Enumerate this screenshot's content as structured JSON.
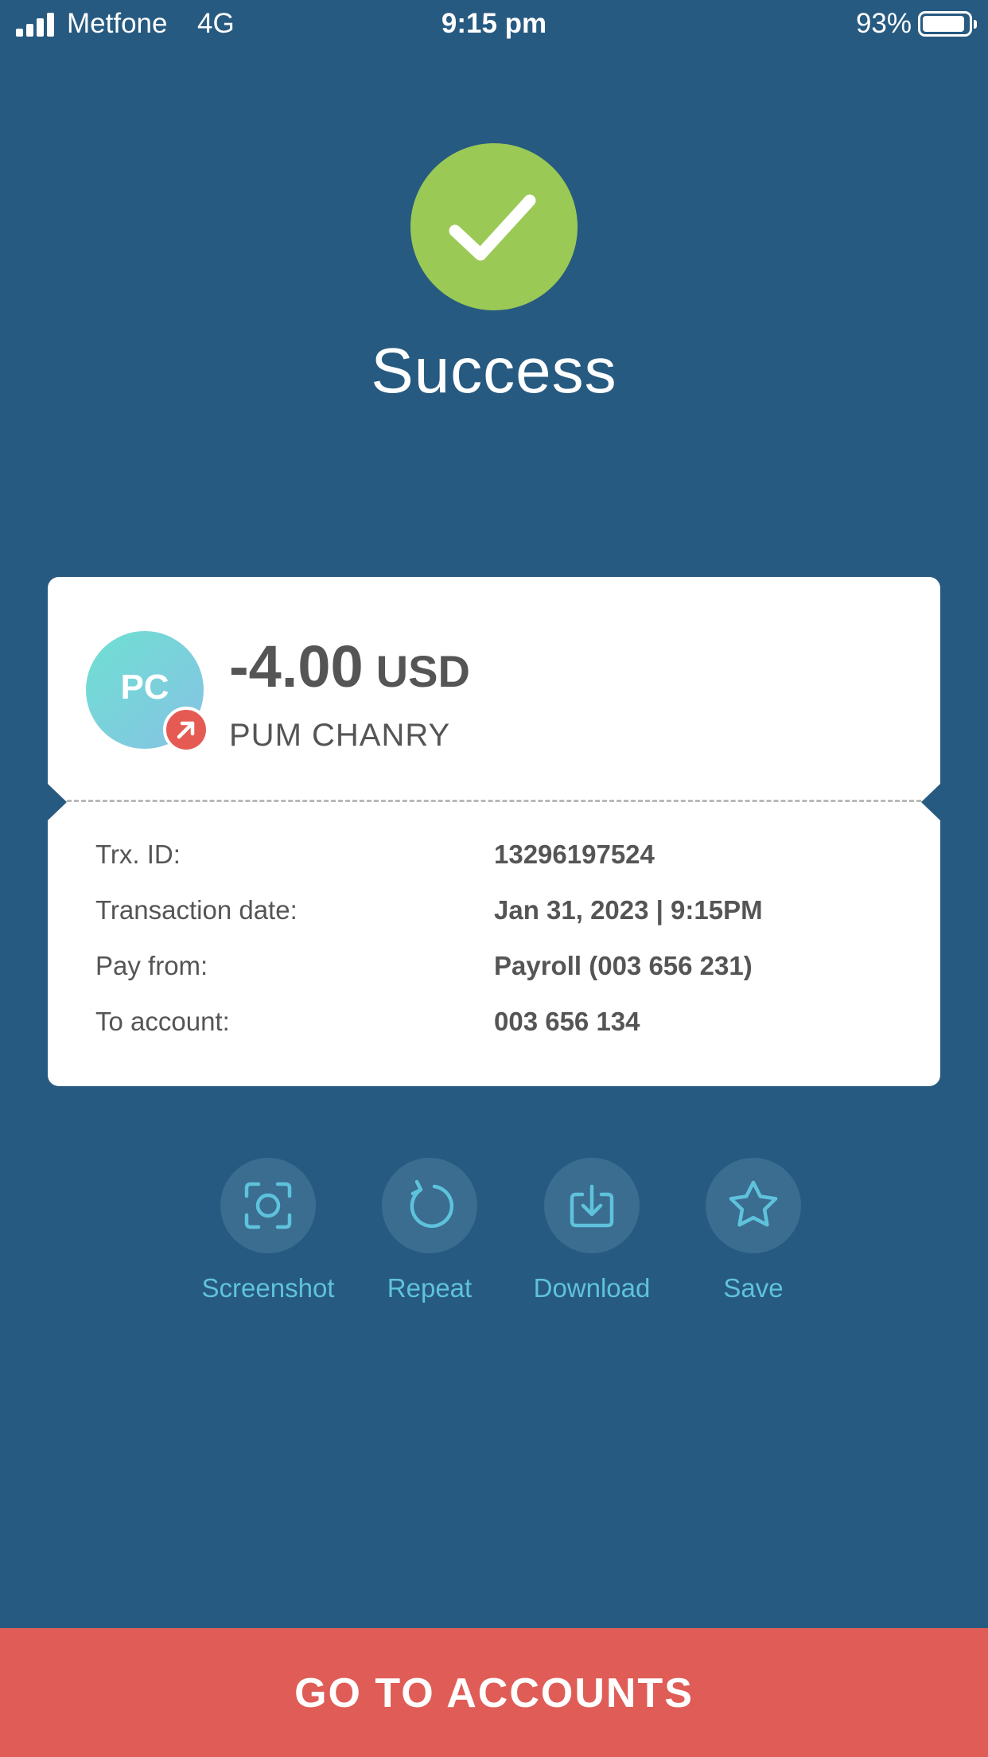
{
  "status_bar": {
    "carrier": "Metfone",
    "network": "4G",
    "time": "9:15 pm",
    "battery": "93%",
    "battery_level": 0.93
  },
  "result": {
    "title": "Success",
    "icon": "checkmark-icon"
  },
  "receipt": {
    "avatar_initials": "PC",
    "direction_icon": "arrow-up-right-icon",
    "amount": "-4.00",
    "currency": "USD",
    "payee": "PUM CHANRY",
    "details": [
      {
        "label": "Trx. ID:",
        "value": "13296197524"
      },
      {
        "label": "Transaction date:",
        "value": "Jan 31, 2023 | 9:15PM"
      },
      {
        "label": "Pay from:",
        "value": "Payroll (003 656 231)"
      },
      {
        "label": "To account:",
        "value": "003 656 134"
      }
    ]
  },
  "actions": [
    {
      "label": "Screenshot",
      "icon": "screenshot-icon"
    },
    {
      "label": "Repeat",
      "icon": "repeat-icon"
    },
    {
      "label": "Download",
      "icon": "download-icon"
    },
    {
      "label": "Save",
      "icon": "star-icon"
    }
  ],
  "cta": {
    "label": "GO TO ACCOUNTS"
  },
  "colors": {
    "background": "#275a80",
    "success_green": "#9bc955",
    "cta_red": "#e05d57",
    "accent_cyan": "#5fc2dc",
    "text_dark": "#555555"
  }
}
